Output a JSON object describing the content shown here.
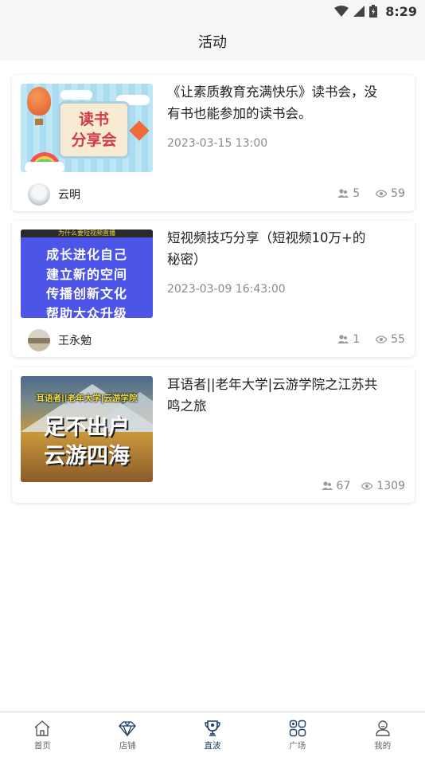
{
  "status_bar": {
    "time": "8:29"
  },
  "header": {
    "title": "活动"
  },
  "activities": [
    {
      "title": "《让素质教育充满快乐》读书会，没有书也能参加的读书会。",
      "date": "2023-03-15 13:00",
      "author": "云明",
      "participants": "5",
      "views": "59",
      "thumbnail": {
        "lines": [
          "读书",
          "分享会"
        ]
      }
    },
    {
      "title": "短视频技巧分享（短视频10万+的秘密）",
      "date": "2023-03-09 16:43:00",
      "author": "王永勉",
      "participants": "1",
      "views": "55",
      "thumbnail": {
        "header": "为什么要短视频直播",
        "lines": [
          "成长进化自己",
          "建立新的空间",
          "传播创新文化",
          "帮助大众升级"
        ]
      }
    },
    {
      "title": "耳语者||老年大学|云游学院之江苏共鸣之旅",
      "participants": "67",
      "views": "1309",
      "thumbnail": {
        "subtitle": "耳语者||老年大学|云游学院",
        "lines": [
          "足不出户",
          "云游四海"
        ]
      }
    }
  ],
  "tabbar": {
    "items": [
      {
        "label": "首页",
        "icon": "home-icon"
      },
      {
        "label": "店铺",
        "icon": "diamond-icon"
      },
      {
        "label": "直波",
        "icon": "trophy-icon",
        "active": true
      },
      {
        "label": "广场",
        "icon": "grid-icon"
      },
      {
        "label": "我的",
        "icon": "user-icon"
      }
    ]
  },
  "colors": {
    "active_tab": "#1f3c63",
    "meta_text": "#8a8a8a"
  }
}
